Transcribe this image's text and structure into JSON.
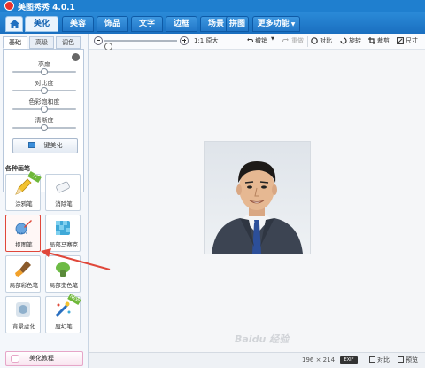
{
  "window": {
    "title": "美图秀秀 4.0.1"
  },
  "menu": {
    "tabs": [
      {
        "label": "美化",
        "active": true
      },
      {
        "label": "美容"
      },
      {
        "label": "饰品"
      },
      {
        "label": "文字"
      },
      {
        "label": "边框"
      },
      {
        "label": "场景"
      },
      {
        "label": "拼图"
      },
      {
        "label": "更多功能"
      }
    ]
  },
  "left_panel": {
    "subtabs": [
      "基础",
      "高级",
      "调色"
    ],
    "sliders": [
      {
        "label": "亮度",
        "value": 0.5
      },
      {
        "label": "对比度",
        "value": 0.5
      },
      {
        "label": "色彩饱和度",
        "value": 0.5
      },
      {
        "label": "清晰度",
        "value": 0.5
      }
    ],
    "one_click": "一键美化",
    "brushes_title": "各种画笔",
    "brushes": [
      {
        "label": "涂鸦笔",
        "icon": "pencil-icon",
        "badge": "元"
      },
      {
        "label": "消除笔",
        "icon": "eraser-icon"
      },
      {
        "label": "抠图笔",
        "icon": "cutout-pen-icon",
        "selected": true
      },
      {
        "label": "局部马赛克",
        "icon": "mosaic-icon"
      },
      {
        "label": "局部彩色笔",
        "icon": "color-brush-icon"
      },
      {
        "label": "局部变色笔",
        "icon": "recolor-brush-icon"
      },
      {
        "label": "背景虚化",
        "icon": "blur-background-icon"
      },
      {
        "label": "魔幻笔",
        "icon": "magic-pen-icon",
        "badge": "NEW"
      }
    ],
    "tutorial": "美化教程"
  },
  "toolbar": {
    "zoom_level": 0.05,
    "actual_size": "1:1 原大",
    "undo": "撤销",
    "redo": "重做",
    "compare": "对比",
    "rotate": "旋转",
    "crop": "裁剪",
    "resize": "尺寸"
  },
  "status": {
    "size": "196 × 214",
    "exif": "EXIF",
    "compare": "对比",
    "preview": "预览"
  },
  "colors": {
    "accent": "#1f7fcf",
    "selected_border": "#e0473a",
    "arrow": "#e0473a"
  },
  "watermark": "Baidu 经验"
}
